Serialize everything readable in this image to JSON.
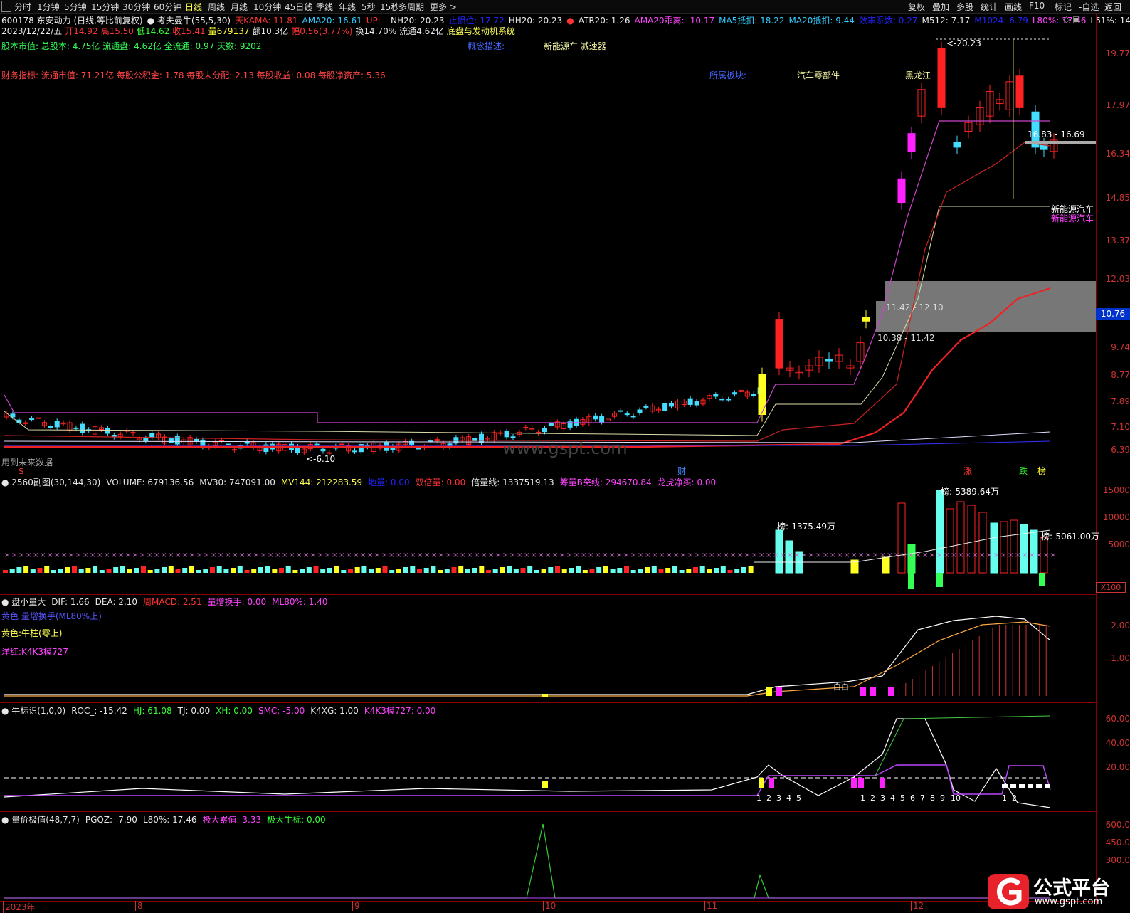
{
  "toolbar": {
    "tabs": [
      "分时",
      "1分钟",
      "5分钟",
      "15分钟",
      "30分钟",
      "60分钟",
      "日线",
      "周线",
      "月线",
      "10分钟",
      "45日线",
      "季线",
      "年线",
      "5秒",
      "15秒",
      "多周期",
      "更多 >"
    ],
    "active_tab": "日线",
    "right_buttons": [
      "复权",
      "叠加",
      "多股",
      "统计",
      "画线",
      "F10",
      "标记",
      "-自选",
      "返回"
    ]
  },
  "header": {
    "line1": [
      {
        "t": "600178 东安动力 (日线,等比前复权)",
        "c": "#e8e8e8"
      },
      {
        "t": "● 考夫曼牛(55,5,30)",
        "c": "#e8e8e8"
      },
      {
        "t": "天KAMA: 11.81",
        "c": "#ff3333"
      },
      {
        "t": "AMA20: 16.61",
        "c": "#33ccff"
      },
      {
        "t": "UP: -",
        "c": "#ff3333"
      },
      {
        "t": "NH20: 20.23",
        "c": "#e8e8e8"
      },
      {
        "t": "止损位: 17.72",
        "c": "#2222ff"
      },
      {
        "t": "HH20: 20.23",
        "c": "#e8e8e8"
      },
      {
        "t": "●",
        "c": "#ff3333"
      },
      {
        "t": "ATR20: 1.26",
        "c": "#e8e8e8"
      },
      {
        "t": "AMA20乖离: -10.17",
        "c": "#ff44ff"
      },
      {
        "t": "MA5抵扣: 18.22",
        "c": "#33ccff"
      },
      {
        "t": "MA20抵扣: 9.44",
        "c": "#33ccff"
      },
      {
        "t": "效率系数: 0.27",
        "c": "#2222ff"
      },
      {
        "t": "M512: 7.17",
        "c": "#e8e8e8"
      },
      {
        "t": "M1024: 6.79",
        "c": "#2222ff"
      },
      {
        "t": "L80%: 17.46",
        "c": "#ff44ff"
      },
      {
        "t": "L61%: 14.68",
        "c": "#e8e8e8"
      }
    ],
    "line2": [
      {
        "t": "2023/12/22/五",
        "c": "#e8e8e8"
      },
      {
        "t": "开14.92",
        "c": "#ff3333"
      },
      {
        "t": "高15.50",
        "c": "#ff3333"
      },
      {
        "t": "低14.62",
        "c": "#33ff33"
      },
      {
        "t": "收15.41",
        "c": "#ff3333"
      },
      {
        "t": "量679137",
        "c": "#ffff33"
      },
      {
        "t": "额10.3亿",
        "c": "#e8e8e8"
      },
      {
        "t": "幅0.56(3.77%)",
        "c": "#ff3333"
      },
      {
        "t": "换14.70%",
        "c": "#e8e8e8"
      },
      {
        "t": "流通4.62亿",
        "c": "#e8e8e8"
      },
      {
        "t": "底盘与发动机系统",
        "c": "#ffff55"
      }
    ],
    "line3": "股本市值: 总股本: 4.75亿 流通盘: 4.62亿 全流通: 0.97 天数: 9202",
    "concept_label": "概念描述:",
    "concept_value": "新能源车 减速器",
    "line4": "财务指标: 流通市值: 71.21亿  每股公积金: 1.78  每股未分配: 2.13  每股收益: 0.08  每股净资产: 5.36",
    "sector_label": "所属板块:",
    "sector1": "汽车零部件",
    "sector2": "黑龙江"
  },
  "main_pane": {
    "y_axis": [
      "19.77",
      "17.97",
      "16.34",
      "14.85",
      "13.37",
      "12.03",
      "10.76",
      "9.74",
      "8.77",
      "7.89",
      "7.10",
      "6.39"
    ],
    "current_price_tag": "10.76",
    "annotations": {
      "high": "20.23",
      "low": "6.10",
      "box1": "16.83 - 16.69",
      "box2": "11.42 - 12.10",
      "box3": "10.38 - 11.42",
      "tag_nev1": "新能源汽车",
      "tag_nev2": "新能源汽车",
      "future_data": "用到未来数据",
      "dollar_mark": "$",
      "cai": "财",
      "zhang": "涨",
      "die": "跌",
      "bang": "榜",
      "watermark": "www.gspt.com"
    },
    "colors": {
      "up": "#ff2222",
      "down": "#44ddff",
      "yellow": "#ffff22",
      "magenta": "#ff22ff"
    }
  },
  "pane2": {
    "title": [
      {
        "t": "● 2560副图(30,144,30)",
        "c": "#e8e8e8"
      },
      {
        "t": "VOLUME: 679136.56",
        "c": "#e8e8e8"
      },
      {
        "t": "MV30: 747091.00",
        "c": "#e8e8e8"
      },
      {
        "t": "MV144: 212283.59",
        "c": "#ffff55"
      },
      {
        "t": "地量: 0.00",
        "c": "#2222ff"
      },
      {
        "t": "双倍量: 0.00",
        "c": "#ff3333"
      },
      {
        "t": "倍量线: 1337519.13",
        "c": "#e8e8e8"
      },
      {
        "t": "筹量B突线: 294670.84",
        "c": "#ff44ff"
      },
      {
        "t": "龙虎净买: 0.00",
        "c": "#ff44ff"
      }
    ],
    "y_axis": [
      "15000",
      "10000",
      "5000"
    ],
    "unit": "X100",
    "labels": [
      "榜:-1375.49万",
      "榜:-5061.00万",
      "榜:-5389.64万",
      "榜:-3"
    ]
  },
  "pane3": {
    "title": [
      {
        "t": "● 盘小量大",
        "c": "#e8e8e8"
      },
      {
        "t": "DIF: 1.66",
        "c": "#e8e8e8"
      },
      {
        "t": "DEA: 2.10",
        "c": "#e8e8e8"
      },
      {
        "t": "周MACD: 2.51",
        "c": "#ff3333"
      },
      {
        "t": "量增换手: 0.00",
        "c": "#ff44ff"
      },
      {
        "t": "ML80%: 1.40",
        "c": "#ff44ff"
      }
    ],
    "legend": [
      {
        "t": "黄色 量增换手(ML80%上)",
        "c": "#5555ff"
      },
      {
        "t": "黄色:牛柱(零上)",
        "c": "#ffff55"
      },
      {
        "t": "洋红:K4K3模727",
        "c": "#ff44ff"
      }
    ],
    "y_axis": [
      "2.00",
      "1.00"
    ],
    "label_white": "白白"
  },
  "pane4": {
    "title": [
      {
        "t": "● 牛标识(1,0,0)",
        "c": "#e8e8e8"
      },
      {
        "t": "ROC_: -15.42",
        "c": "#e8e8e8"
      },
      {
        "t": "HJ: 61.08",
        "c": "#33ff33"
      },
      {
        "t": "TJ: 0.00",
        "c": "#e8e8e8"
      },
      {
        "t": "XH: 0.00",
        "c": "#33ff33"
      },
      {
        "t": "SMC: -5.00",
        "c": "#ff44ff"
      },
      {
        "t": "K4XG: 1.00",
        "c": "#e8e8e8"
      },
      {
        "t": "K4K3模727: 0.00",
        "c": "#ff44ff"
      }
    ],
    "y_axis": [
      "60.00",
      "40.00",
      "20.00"
    ],
    "counts": [
      "1",
      "2",
      "3",
      "4",
      "5",
      "1",
      "2",
      "3",
      "4",
      "5",
      "6",
      "7",
      "8",
      "9",
      "10",
      "1",
      "2"
    ]
  },
  "pane5": {
    "title": [
      {
        "t": "● 量价极值(48,7,7)",
        "c": "#e8e8e8"
      },
      {
        "t": "PGQZ: -7.90",
        "c": "#e8e8e8"
      },
      {
        "t": "L80%: 17.46",
        "c": "#e8e8e8"
      },
      {
        "t": "极大累值: 3.33",
        "c": "#ff44ff"
      },
      {
        "t": "极大牛标: 0.00",
        "c": "#33ff33"
      }
    ],
    "y_axis": [
      "600.0",
      "450.0",
      "300.0"
    ]
  },
  "x_axis": [
    "2023年",
    "8",
    "9",
    "10",
    "11",
    "12"
  ],
  "logo": {
    "text": "公式平台",
    "url_text": "www.gspt.com"
  }
}
